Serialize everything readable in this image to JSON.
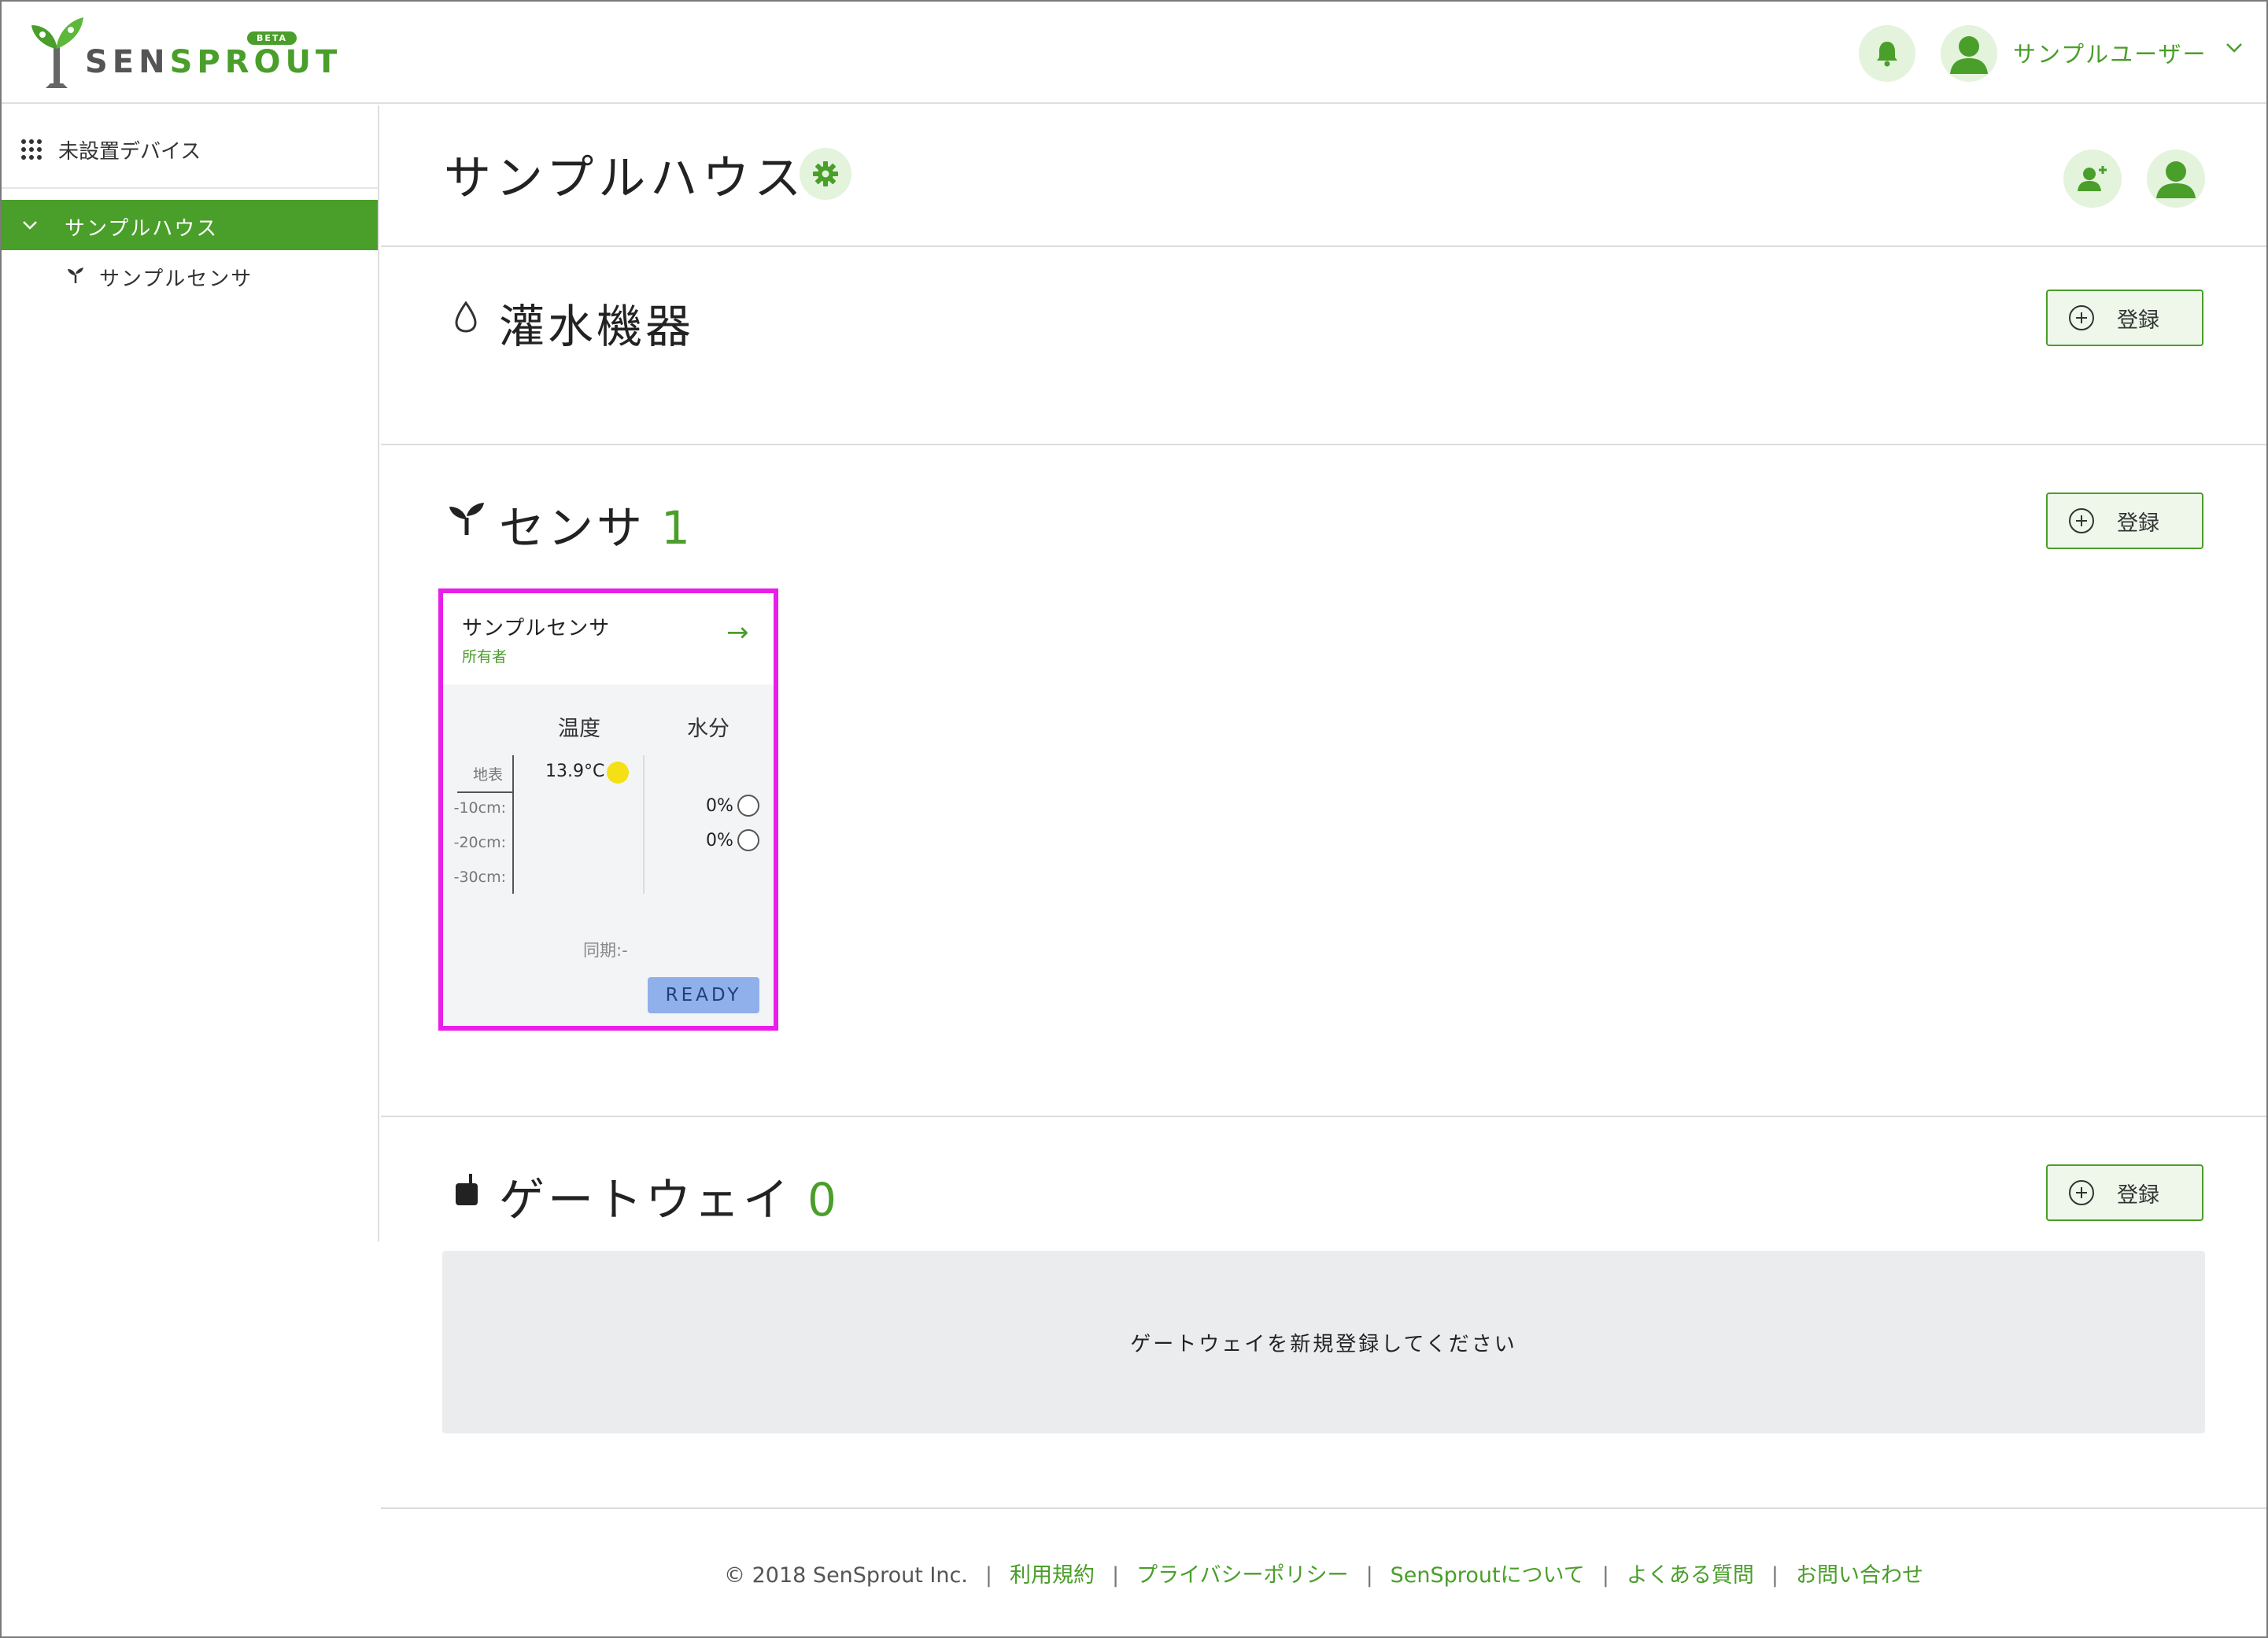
{
  "header": {
    "logo_text_main": "SENSPROUT",
    "beta_label": "BETA",
    "user_name": "サンプルユーザー"
  },
  "sidebar": {
    "unplaced_label": "未設置デバイス",
    "house_label": "サンプルハウス",
    "sensor_label": "サンプルセンサ"
  },
  "main": {
    "title": "サンプルハウス",
    "irrigation": {
      "title": "灌水機器",
      "register_label": "登録"
    },
    "sensors": {
      "title": "センサ",
      "count": "1",
      "register_label": "登録",
      "card": {
        "name": "サンプルセンサ",
        "role": "所有者",
        "arrow": "→",
        "col_temp": "温度",
        "col_moisture": "水分",
        "depth_labels": [
          "地表",
          "-10cm:",
          "-20cm:",
          "-30cm:"
        ],
        "temp_surface": "13.9°C",
        "moisture_10": "0%",
        "moisture_20": "0%",
        "sync": "同期:-",
        "status": "READY"
      }
    },
    "gateway": {
      "title": "ゲートウェイ",
      "count": "0",
      "register_label": "登録",
      "empty_message": "ゲートウェイを新規登録してください"
    }
  },
  "footer": {
    "copyright": "© 2018 SenSprout Inc.",
    "links": [
      "利用規約",
      "プライバシーポリシー",
      "SenSproutについて",
      "よくある質問",
      "お問い合わせ"
    ]
  },
  "colors": {
    "brand_green": "#4a9e2a",
    "light_green": "#e3f3dc",
    "highlight_magenta": "#e91ee9",
    "ready_blue": "#8fb0ea",
    "temp_indicator": "#f4e014"
  }
}
